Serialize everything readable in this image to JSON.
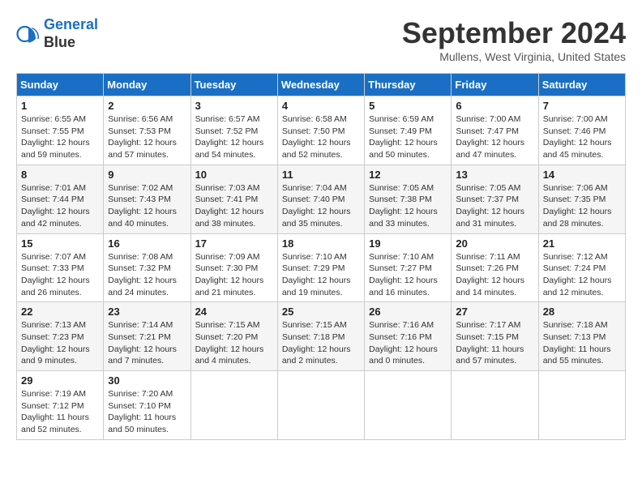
{
  "header": {
    "logo_line1": "General",
    "logo_line2": "Blue",
    "month_title": "September 2024",
    "location": "Mullens, West Virginia, United States"
  },
  "weekdays": [
    "Sunday",
    "Monday",
    "Tuesday",
    "Wednesday",
    "Thursday",
    "Friday",
    "Saturday"
  ],
  "weeks": [
    [
      {
        "day": "1",
        "sunrise": "6:55 AM",
        "sunset": "7:55 PM",
        "daylight": "12 hours and 59 minutes."
      },
      {
        "day": "2",
        "sunrise": "6:56 AM",
        "sunset": "7:53 PM",
        "daylight": "12 hours and 57 minutes."
      },
      {
        "day": "3",
        "sunrise": "6:57 AM",
        "sunset": "7:52 PM",
        "daylight": "12 hours and 54 minutes."
      },
      {
        "day": "4",
        "sunrise": "6:58 AM",
        "sunset": "7:50 PM",
        "daylight": "12 hours and 52 minutes."
      },
      {
        "day": "5",
        "sunrise": "6:59 AM",
        "sunset": "7:49 PM",
        "daylight": "12 hours and 50 minutes."
      },
      {
        "day": "6",
        "sunrise": "7:00 AM",
        "sunset": "7:47 PM",
        "daylight": "12 hours and 47 minutes."
      },
      {
        "day": "7",
        "sunrise": "7:00 AM",
        "sunset": "7:46 PM",
        "daylight": "12 hours and 45 minutes."
      }
    ],
    [
      {
        "day": "8",
        "sunrise": "7:01 AM",
        "sunset": "7:44 PM",
        "daylight": "12 hours and 42 minutes."
      },
      {
        "day": "9",
        "sunrise": "7:02 AM",
        "sunset": "7:43 PM",
        "daylight": "12 hours and 40 minutes."
      },
      {
        "day": "10",
        "sunrise": "7:03 AM",
        "sunset": "7:41 PM",
        "daylight": "12 hours and 38 minutes."
      },
      {
        "day": "11",
        "sunrise": "7:04 AM",
        "sunset": "7:40 PM",
        "daylight": "12 hours and 35 minutes."
      },
      {
        "day": "12",
        "sunrise": "7:05 AM",
        "sunset": "7:38 PM",
        "daylight": "12 hours and 33 minutes."
      },
      {
        "day": "13",
        "sunrise": "7:05 AM",
        "sunset": "7:37 PM",
        "daylight": "12 hours and 31 minutes."
      },
      {
        "day": "14",
        "sunrise": "7:06 AM",
        "sunset": "7:35 PM",
        "daylight": "12 hours and 28 minutes."
      }
    ],
    [
      {
        "day": "15",
        "sunrise": "7:07 AM",
        "sunset": "7:33 PM",
        "daylight": "12 hours and 26 minutes."
      },
      {
        "day": "16",
        "sunrise": "7:08 AM",
        "sunset": "7:32 PM",
        "daylight": "12 hours and 24 minutes."
      },
      {
        "day": "17",
        "sunrise": "7:09 AM",
        "sunset": "7:30 PM",
        "daylight": "12 hours and 21 minutes."
      },
      {
        "day": "18",
        "sunrise": "7:10 AM",
        "sunset": "7:29 PM",
        "daylight": "12 hours and 19 minutes."
      },
      {
        "day": "19",
        "sunrise": "7:10 AM",
        "sunset": "7:27 PM",
        "daylight": "12 hours and 16 minutes."
      },
      {
        "day": "20",
        "sunrise": "7:11 AM",
        "sunset": "7:26 PM",
        "daylight": "12 hours and 14 minutes."
      },
      {
        "day": "21",
        "sunrise": "7:12 AM",
        "sunset": "7:24 PM",
        "daylight": "12 hours and 12 minutes."
      }
    ],
    [
      {
        "day": "22",
        "sunrise": "7:13 AM",
        "sunset": "7:23 PM",
        "daylight": "12 hours and 9 minutes."
      },
      {
        "day": "23",
        "sunrise": "7:14 AM",
        "sunset": "7:21 PM",
        "daylight": "12 hours and 7 minutes."
      },
      {
        "day": "24",
        "sunrise": "7:15 AM",
        "sunset": "7:20 PM",
        "daylight": "12 hours and 4 minutes."
      },
      {
        "day": "25",
        "sunrise": "7:15 AM",
        "sunset": "7:18 PM",
        "daylight": "12 hours and 2 minutes."
      },
      {
        "day": "26",
        "sunrise": "7:16 AM",
        "sunset": "7:16 PM",
        "daylight": "12 hours and 0 minutes."
      },
      {
        "day": "27",
        "sunrise": "7:17 AM",
        "sunset": "7:15 PM",
        "daylight": "11 hours and 57 minutes."
      },
      {
        "day": "28",
        "sunrise": "7:18 AM",
        "sunset": "7:13 PM",
        "daylight": "11 hours and 55 minutes."
      }
    ],
    [
      {
        "day": "29",
        "sunrise": "7:19 AM",
        "sunset": "7:12 PM",
        "daylight": "11 hours and 52 minutes."
      },
      {
        "day": "30",
        "sunrise": "7:20 AM",
        "sunset": "7:10 PM",
        "daylight": "11 hours and 50 minutes."
      },
      null,
      null,
      null,
      null,
      null
    ]
  ]
}
